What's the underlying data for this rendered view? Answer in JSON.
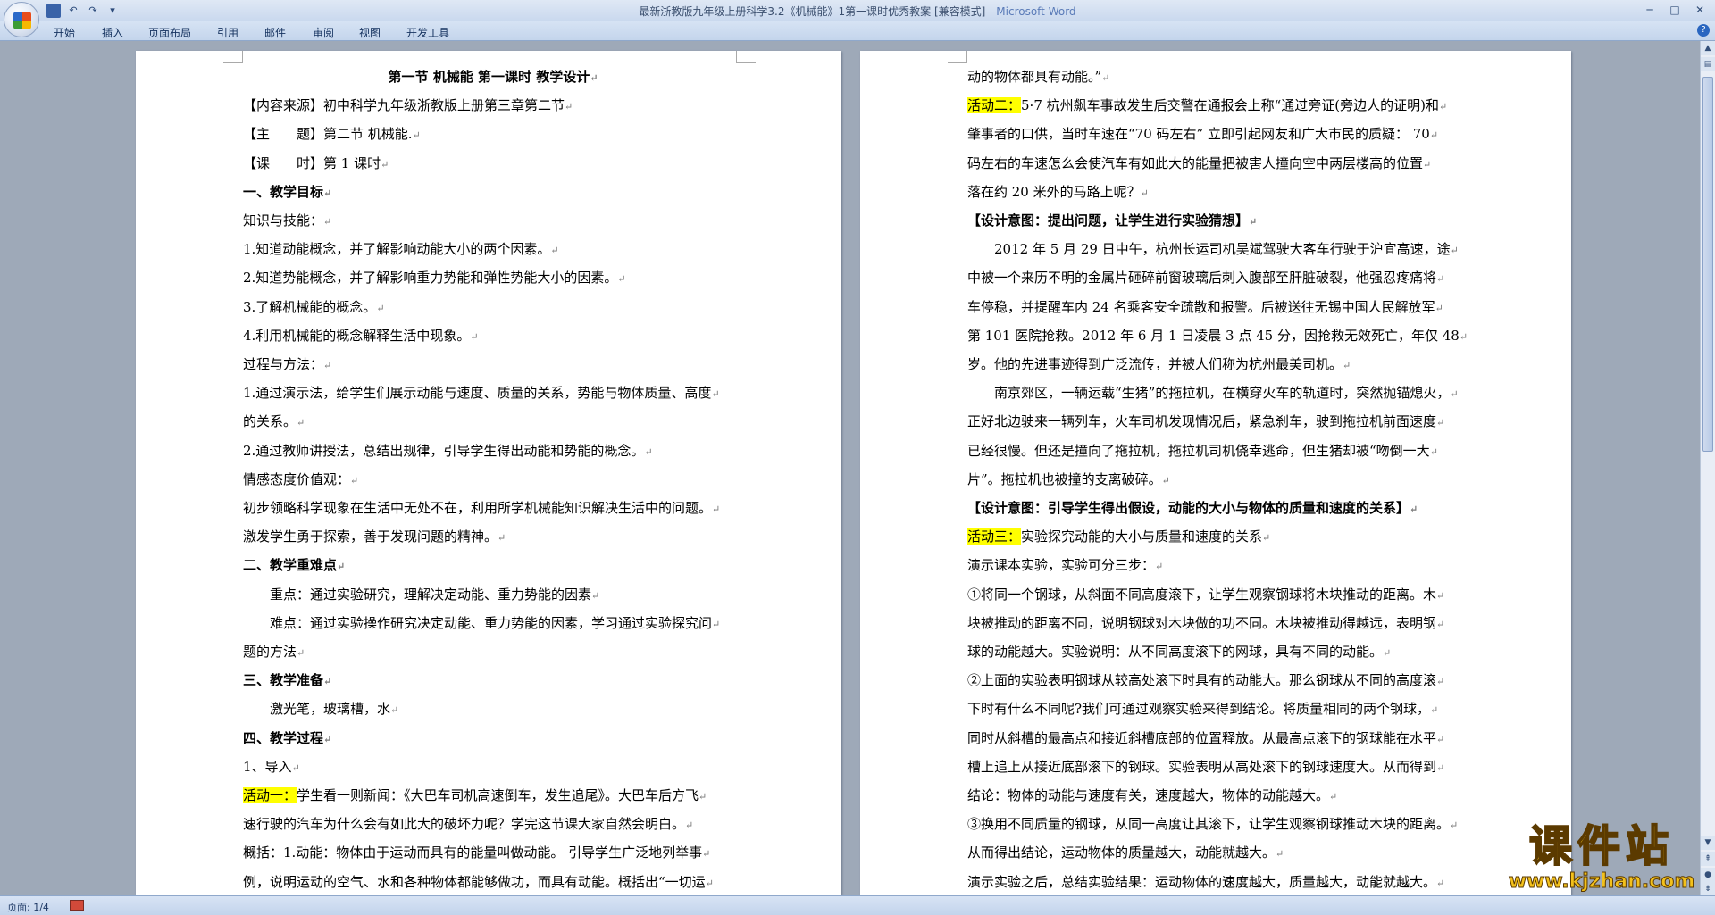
{
  "window": {
    "title": "最新浙教版九年级上册科学3.2《机械能》1第一课时优秀教案 [兼容模式] - ",
    "app": "Microsoft Word"
  },
  "ribbon": {
    "tabs": [
      "开始",
      "插入",
      "页面布局",
      "引用",
      "邮件",
      "审阅",
      "视图",
      "开发工具"
    ]
  },
  "status": {
    "page": "页面: 1/4"
  },
  "watermark": {
    "text": "课件站",
    "url": "www.kjzhan.com"
  },
  "page1": [
    {
      "t": "第一节 机械能 第一课时 教学设计",
      "s": "center"
    },
    {
      "t": "【内容来源】初中科学九年级浙教版上册第三章第二节"
    },
    {
      "t": "【主　　题】第二节 机械能."
    },
    {
      "t": "【课　　时】第 1 课时"
    },
    {
      "t": "一、教学目标",
      "s": "bold"
    },
    {
      "t": "知识与技能："
    },
    {
      "t": "1.知道动能概念，并了解影响动能大小的两个因素。"
    },
    {
      "t": "2.知道势能概念，并了解影响重力势能和弹性势能大小的因素。"
    },
    {
      "t": "3.了解机械能的概念。"
    },
    {
      "t": "4.利用机械能的概念解释生活中现象。"
    },
    {
      "t": "过程与方法："
    },
    {
      "t": "1.通过演示法，给学生们展示动能与速度、质量的关系，势能与物体质量、高度"
    },
    {
      "t": "的关系。"
    },
    {
      "t": "2.通过教师讲授法，总结出规律，引导学生得出动能和势能的概念。"
    },
    {
      "t": "情感态度价值观："
    },
    {
      "t": "初步领略科学现象在生活中无处不在，利用所学机械能知识解决生活中的问题。"
    },
    {
      "t": "激发学生勇于探索，善于发现问题的精神。"
    },
    {
      "t": "二、教学重难点",
      "s": "bold"
    },
    {
      "t": "重点：通过实验研究，理解决定动能、重力势能的因素",
      "s": "indent"
    },
    {
      "t": "难点：通过实验操作研究决定动能、重力势能的因素，学习通过实验探究问",
      "s": "indent"
    },
    {
      "t": "题的方法"
    },
    {
      "t": "三、教学准备",
      "s": "bold"
    },
    {
      "t": "激光笔，玻璃槽，水",
      "s": "indent"
    },
    {
      "t": "四、教学过程",
      "s": "bold"
    },
    {
      "t": "1、导入"
    },
    {
      "h": "活动一：",
      "t": "学生看一则新闻：《大巴车司机高速倒车，发生追尾》。大巴车后方飞"
    },
    {
      "t": "速行驶的汽车为什么会有如此大的破坏力呢？学完这节课大家自然会明白。"
    },
    {
      "t": "概括：1.动能：物体由于运动而具有的能量叫做动能。 引导学生广泛地列举事"
    },
    {
      "t": "例，说明运动的空气、水和各种物体都能够做功，而具有动能。概括出“一切运"
    }
  ],
  "page2": [
    {
      "t": "动的物体都具有动能。”"
    },
    {
      "h": "活动二：",
      "t": "5·7 杭州飙车事故发生后交警在通报会上称“通过旁证(旁边人的证明)和"
    },
    {
      "t": "肇事者的口供，当时车速在“70 码左右” 立即引起网友和广大市民的质疑： 70"
    },
    {
      "t": "码左右的车速怎么会使汽车有如此大的能量把被害人撞向空中两层楼高的位置"
    },
    {
      "t": "落在约 20 米外的马路上呢？"
    },
    {
      "t": "【设计意图：提出问题，让学生进行实验猜想】",
      "s": "bold"
    },
    {
      "t": "2012 年 5 月 29 日中午，杭州长运司机吴斌驾驶大客车行驶于沪宜高速，途",
      "s": "indent"
    },
    {
      "t": "中被一个来历不明的金属片砸碎前窗玻璃后刺入腹部至肝脏破裂，他强忍疼痛将"
    },
    {
      "t": "车停稳，并提醒车内 24 名乘客安全疏散和报警。后被送往无锡中国人民解放军"
    },
    {
      "t": "第 101 医院抢救。2012 年 6 月 1 日凌晨 3 点 45 分，因抢救无效死亡，年仅 48"
    },
    {
      "t": "岁。他的先进事迹得到广泛流传，并被人们称为杭州最美司机。"
    },
    {
      "t": "南京郊区，一辆运载“生猪”的拖拉机，在横穿火车的轨道时，突然抛锚熄火，",
      "s": "indent"
    },
    {
      "t": "正好北边驶来一辆列车，火车司机发现情况后，紧急刹车，驶到拖拉机前面速度"
    },
    {
      "t": "已经很慢。但还是撞向了拖拉机，拖拉机司机侥幸逃命，但生猪却被“吻倒一大"
    },
    {
      "t": "片”。拖拉机也被撞的支离破碎。"
    },
    {
      "t": "【设计意图：引导学生得出假设，动能的大小与物体的质量和速度的关系】",
      "s": "bold"
    },
    {
      "h": "活动三：",
      "t": "实验探究动能的大小与质量和速度的关系"
    },
    {
      "t": "演示课本实验，实验可分三步："
    },
    {
      "t": "①将同一个钢球，从斜面不同高度滚下，让学生观察钢球将木块推动的距离。木"
    },
    {
      "t": "块被推动的距离不同，说明钢球对木块做的功不同。木块被推动得越远，表明钢"
    },
    {
      "t": "球的动能越大。实验说明：从不同高度滚下的网球，具有不同的动能。"
    },
    {
      "t": "②上面的实验表明钢球从较高处滚下时具有的动能大。那么钢球从不同的高度滚"
    },
    {
      "t": "下时有什么不同呢?我们可通过观察实验来得到结论。将质量相同的两个钢球，"
    },
    {
      "t": "同时从斜槽的最高点和接近斜槽底部的位置释放。从最高点滚下的钢球能在水平"
    },
    {
      "t": "槽上追上从接近底部滚下的钢球。实验表明从高处滚下的钢球速度大。从而得到"
    },
    {
      "t": "结论：物体的动能与速度有关，速度越大，物体的动能越大。"
    },
    {
      "t": "③换用不同质量的钢球，从同一高度让其滚下，让学生观察钢球推动木块的距离。"
    },
    {
      "t": "从而得出结论，运动物体的质量越大，动能就越大。"
    },
    {
      "t": "演示实验之后，总结实验结果：运动物体的速度越大，质量越大，动能就越大。"
    }
  ]
}
